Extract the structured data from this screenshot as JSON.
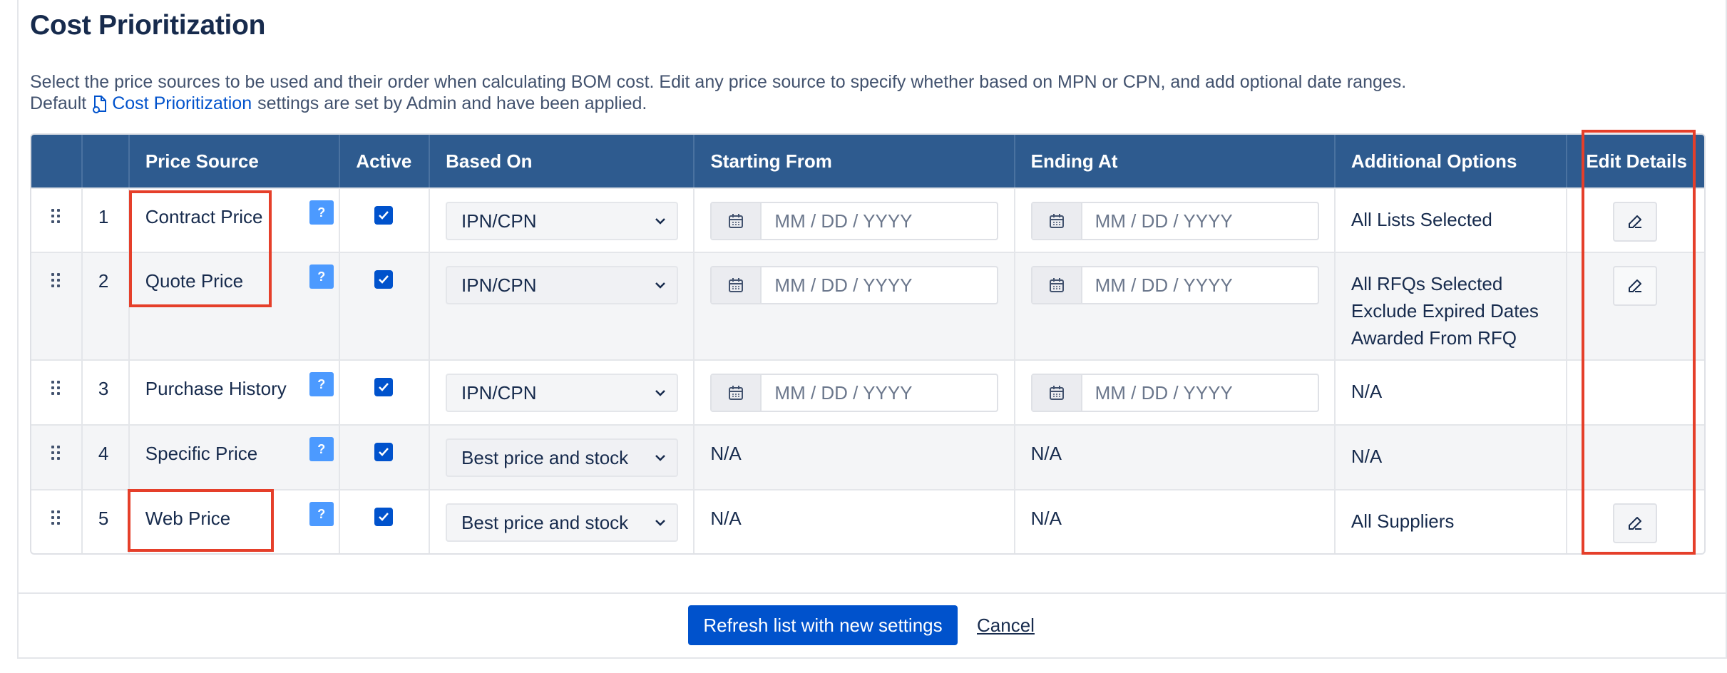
{
  "page": {
    "title": "Cost Prioritization",
    "description_line1": "Select the price sources to be used and their order when calculating BOM cost. Edit any price source to specify whether based on MPN or CPN, and add optional date ranges.",
    "description_prefix": "Default",
    "description_link": "Cost Prioritization",
    "description_suffix": "settings are set by Admin and have been applied."
  },
  "table": {
    "headers": {
      "price_source": "Price Source",
      "active": "Active",
      "based_on": "Based On",
      "starting_from": "Starting From",
      "ending_at": "Ending At",
      "additional_options": "Additional Options",
      "edit_details": "Edit Details"
    },
    "date_placeholder": "MM / DD / YYYY",
    "help_label": "?",
    "rows": [
      {
        "num": "1",
        "source": "Contract Price",
        "active": true,
        "based_on": "IPN/CPN",
        "start": "MM / DD / YYYY",
        "end": "MM / DD / YYYY",
        "options": "All Lists Selected",
        "editable": true
      },
      {
        "num": "2",
        "source": "Quote Price",
        "active": true,
        "based_on": "IPN/CPN",
        "start": "MM / DD / YYYY",
        "end": "MM / DD / YYYY",
        "options_lines": [
          "All RFQs Selected",
          "Exclude Expired Dates",
          "Awarded From RFQ"
        ],
        "editable": true
      },
      {
        "num": "3",
        "source": "Purchase History",
        "active": true,
        "based_on": "IPN/CPN",
        "start": "MM / DD / YYYY",
        "end": "MM / DD / YYYY",
        "options": "N/A",
        "editable": false
      },
      {
        "num": "4",
        "source": "Specific Price",
        "active": true,
        "based_on": "Best price and stock",
        "start": "N/A",
        "end": "N/A",
        "options": "N/A",
        "editable": false
      },
      {
        "num": "5",
        "source": "Web Price",
        "active": true,
        "based_on": "Best price and stock",
        "start": "N/A",
        "end": "N/A",
        "options": "All Suppliers",
        "editable": true
      }
    ]
  },
  "footer": {
    "refresh_label": "Refresh list with new settings",
    "cancel_label": "Cancel"
  },
  "colors": {
    "header_bg": "#2e5b8f",
    "primary": "#0052cc",
    "highlight": "#e53f2a"
  }
}
